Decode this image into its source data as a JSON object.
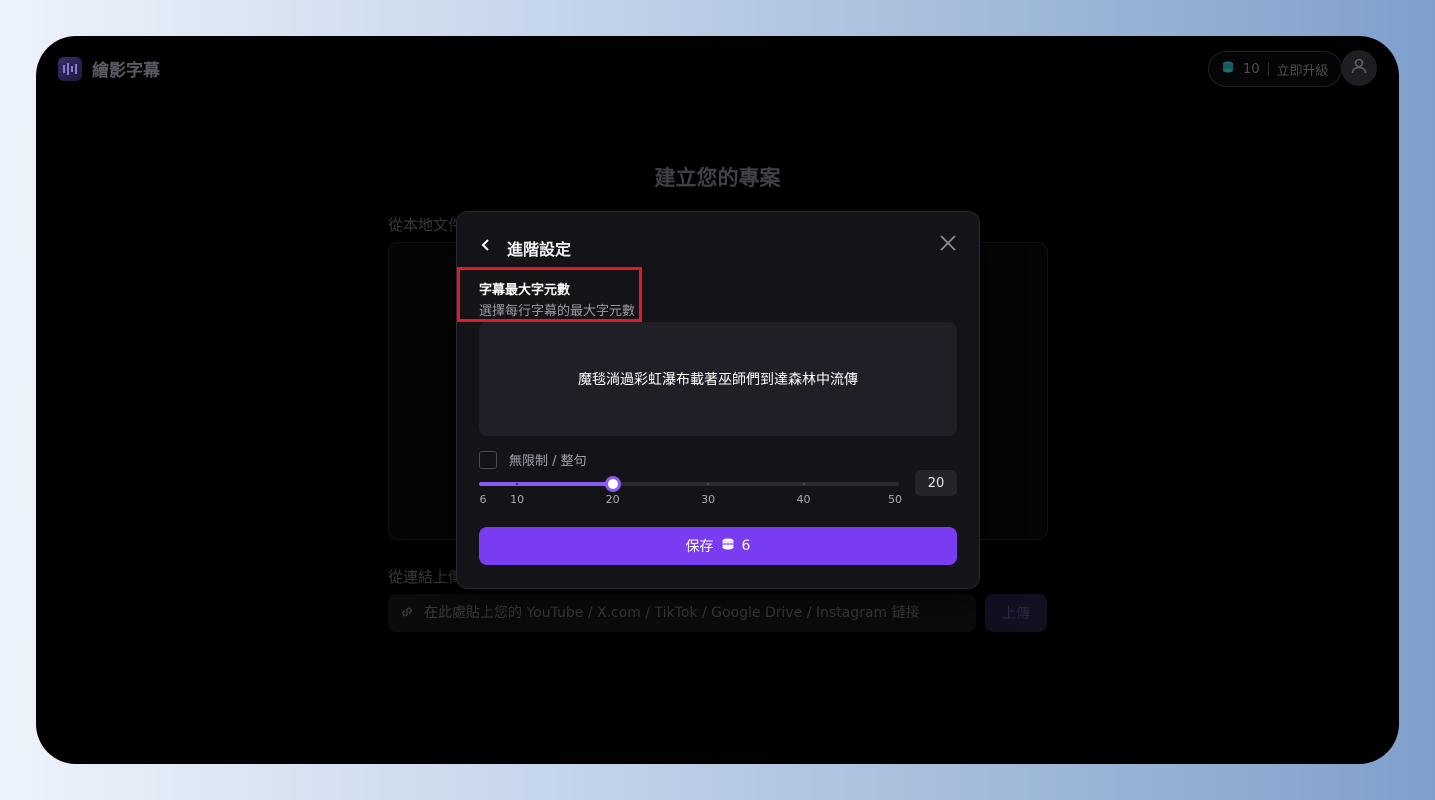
{
  "header": {
    "app_name": "繪影字幕",
    "credits_count": "10",
    "upgrade_label": "立即升級",
    "icons": [
      "logo-icon",
      "coins-icon",
      "user-icon"
    ]
  },
  "main": {
    "title": "建立您的專案",
    "local_label": "從本地文件",
    "link_label": "從連結上傳",
    "link_placeholder": "在此處貼上您的 YouTube / X.com / TikTok / Google Drive / Instagram 鏈接",
    "upload_label": "上傳"
  },
  "modal": {
    "title": "進階設定",
    "section_title": "字幕最大字元數",
    "section_desc": "選擇每行字幕的最大字元數",
    "preview_text": "魔毯淌過彩虹瀑布載著巫師們到達森林中流傳",
    "checkbox_label": "無限制 / 整句",
    "checkbox_checked": false,
    "slider": {
      "min": 6,
      "max": 50,
      "value": 20,
      "ticks": [
        "6",
        "10",
        "20",
        "30",
        "40",
        "50"
      ],
      "accent_color": "#8a5cf2"
    },
    "value_display": "20",
    "save_label": "保存",
    "save_cost": "6",
    "save_color": "#7a3cf0"
  },
  "annotations": {
    "highlight_color": "#e2192c"
  }
}
